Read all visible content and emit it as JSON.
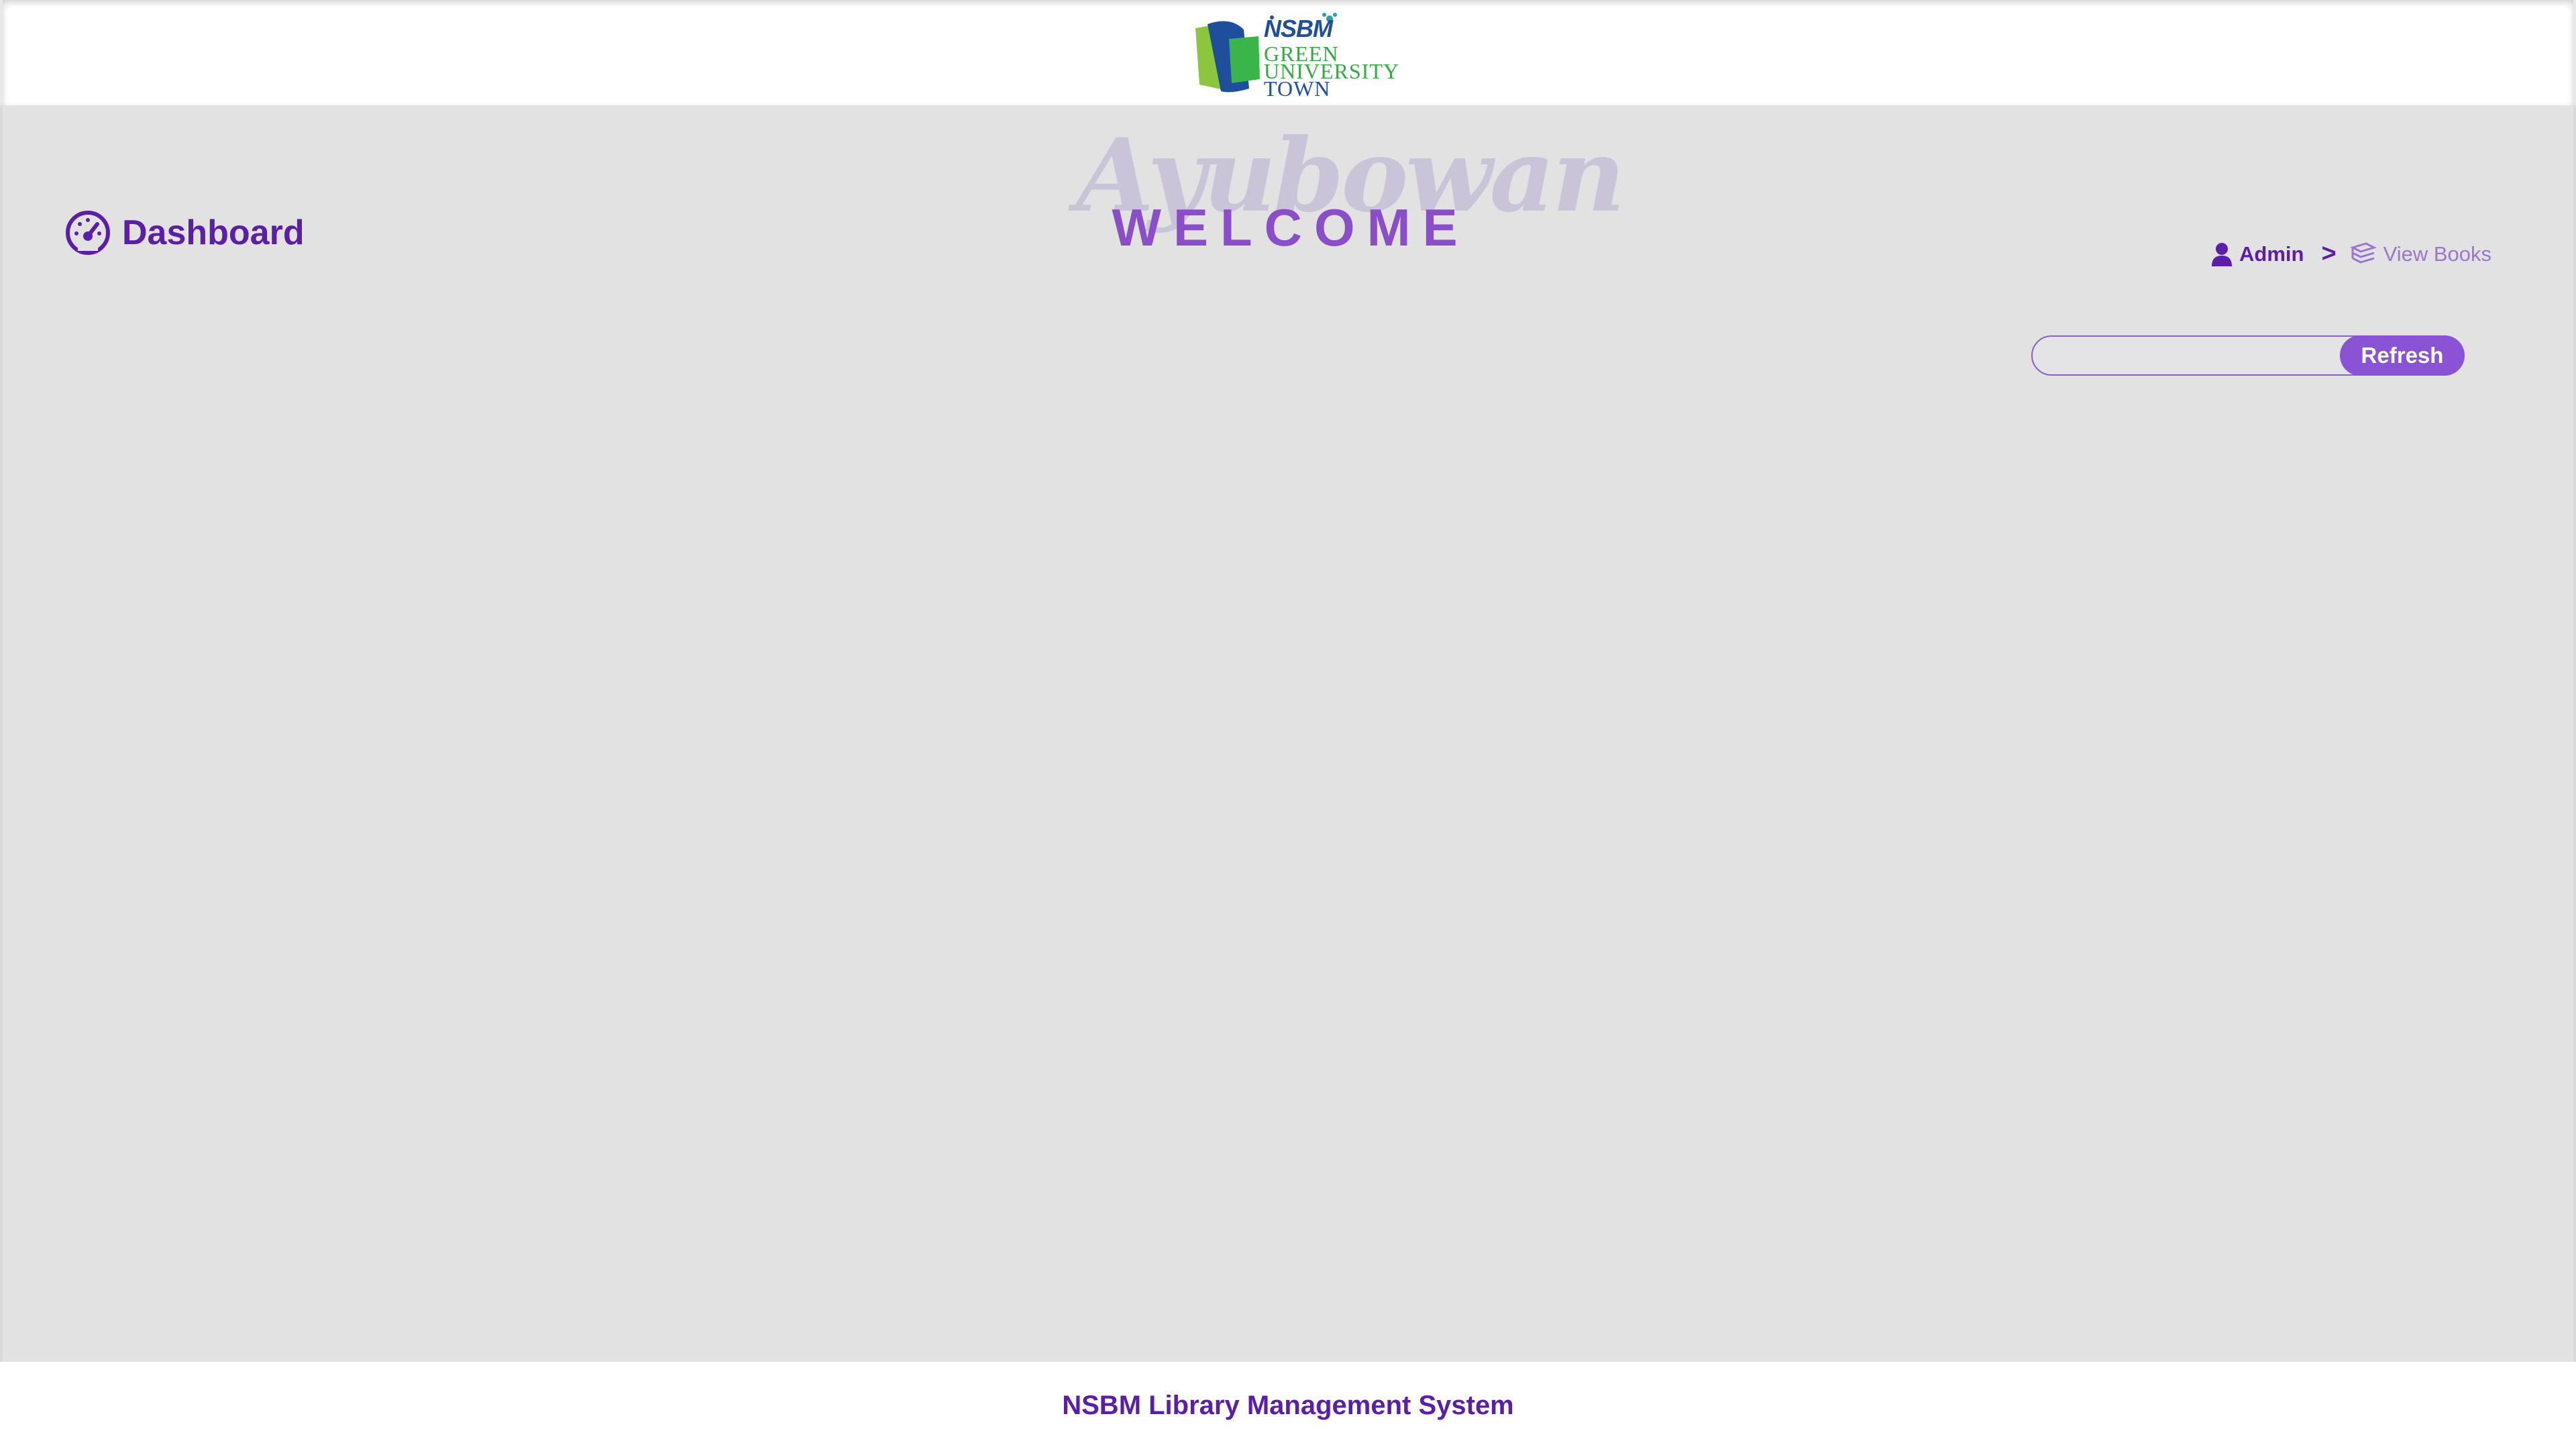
{
  "header": {
    "logo": {
      "brand": "NSBM",
      "line1": "GREEN",
      "line2": "UNIVERSITY",
      "line3": "TOWN"
    }
  },
  "main": {
    "page_title": "Dashboard",
    "page_icon": "speedometer-icon",
    "greeting_script": "Ayubowan",
    "greeting": "WELCOME",
    "breadcrumb": {
      "admin_label": "Admin",
      "admin_icon": "user-icon",
      "separator": ">",
      "current_label": "View Books",
      "current_icon": "books-icon"
    },
    "search": {
      "value": "",
      "placeholder": "",
      "refresh_label": "Refresh"
    }
  },
  "footer": {
    "text": "NSBM Library Management System"
  },
  "colors": {
    "accent": "#5b1ea8",
    "accent_light": "#8a52d4",
    "background": "#e2e2e3"
  }
}
